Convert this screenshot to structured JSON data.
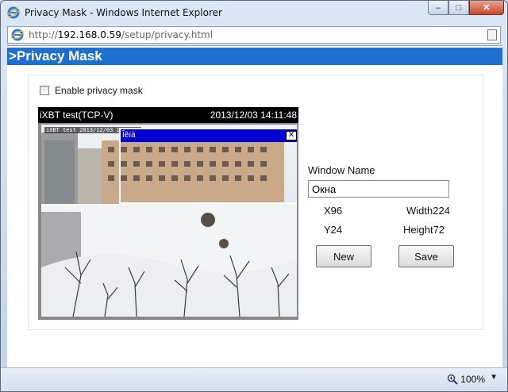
{
  "window": {
    "title": "Privacy Mask - Windows Internet Explorer",
    "minimize": "–",
    "maximize": "□",
    "close": "✕"
  },
  "address": {
    "prefix": "http://",
    "host": "192.168.0.59",
    "path": "/setup/privacy.html"
  },
  "page": {
    "header": ">Privacy Mask",
    "enable_label": "Enable privacy mask",
    "enable_checked": false
  },
  "video": {
    "camera_name": "iXBT test(TCP-V)",
    "timestamp": "2013/12/03 14:11:48",
    "osd_text": "iXBT test 2013/12/03 14:11:4",
    "mask_title": "Îêíà",
    "mask_close": "✕"
  },
  "form": {
    "window_name_label": "Window Name",
    "window_name_value": "Окна",
    "x_label": "X96",
    "width_label": "Width224",
    "y_label": "Y24",
    "height_label": "Height72",
    "new_label": "New",
    "save_label": "Save"
  },
  "status": {
    "zoom": "100%",
    "zoom_dropdown": "▼"
  },
  "colors": {
    "header_blue": "#1f6fd0",
    "mask_bar": "#0000d0"
  }
}
